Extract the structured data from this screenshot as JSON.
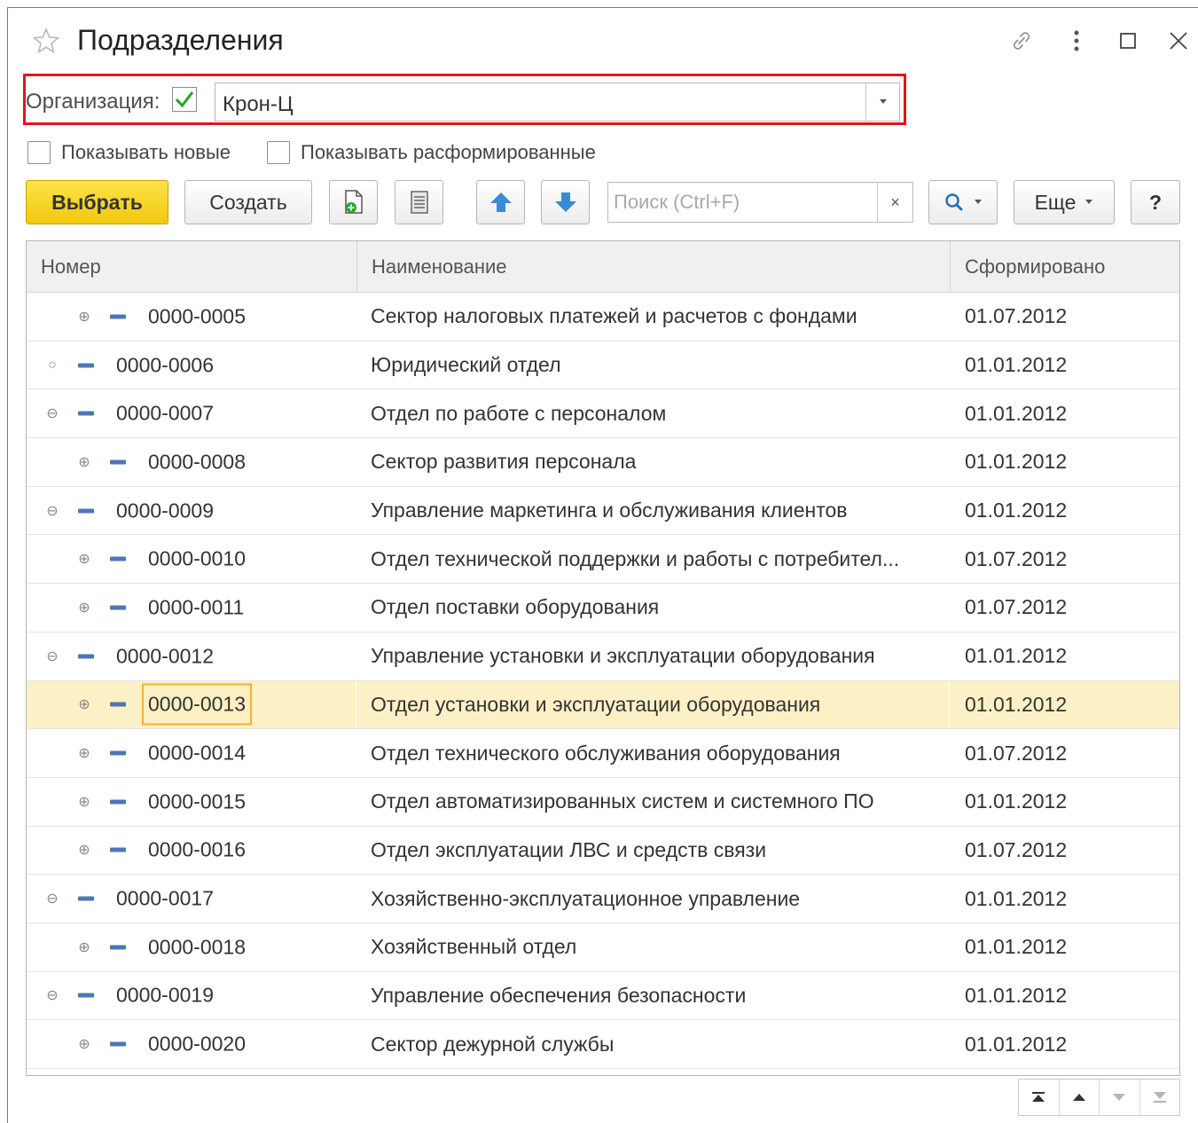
{
  "window": {
    "title": "Подразделения"
  },
  "organization": {
    "label": "Организация:",
    "checked": true,
    "value": "Крон-Ц"
  },
  "filters": {
    "show_new": "Показывать новые",
    "show_disbanded": "Показывать расформированные"
  },
  "toolbar": {
    "select": "Выбрать",
    "create": "Создать",
    "search_placeholder": "Поиск (Ctrl+F)",
    "search_clear": "×",
    "more": "Еще",
    "help": "?"
  },
  "table": {
    "columns": [
      "Номер",
      "Наименование",
      "Сформировано"
    ],
    "rows": [
      {
        "level": 2,
        "toggle": "plus",
        "number": "0000-0005",
        "name": "Сектор налоговых платежей и расчетов с фондами",
        "date": "01.07.2012"
      },
      {
        "level": 1,
        "toggle": "circle",
        "number": "0000-0006",
        "name": "Юридический отдел",
        "date": "01.01.2012"
      },
      {
        "level": 1,
        "toggle": "minus",
        "number": "0000-0007",
        "name": "Отдел по работе с персоналом",
        "date": "01.01.2012"
      },
      {
        "level": 2,
        "toggle": "plus",
        "number": "0000-0008",
        "name": "Сектор развития персонала",
        "date": "01.01.2012"
      },
      {
        "level": 1,
        "toggle": "minus",
        "number": "0000-0009",
        "name": "Управление маркетинга и обслуживания клиентов",
        "date": "01.01.2012"
      },
      {
        "level": 2,
        "toggle": "plus",
        "number": "0000-0010",
        "name": "Отдел технической поддержки и работы с потребител...",
        "date": "01.07.2012"
      },
      {
        "level": 2,
        "toggle": "plus",
        "number": "0000-0011",
        "name": "Отдел поставки оборудования",
        "date": "01.07.2012"
      },
      {
        "level": 1,
        "toggle": "minus",
        "number": "0000-0012",
        "name": "Управление установки и эксплуатации оборудования",
        "date": "01.01.2012"
      },
      {
        "level": 2,
        "toggle": "plus",
        "number": "0000-0013",
        "name": "Отдел установки и эксплуатации оборудования",
        "date": "01.01.2012",
        "selected": true
      },
      {
        "level": 2,
        "toggle": "plus",
        "number": "0000-0014",
        "name": "Отдел технического обслуживания оборудования",
        "date": "01.07.2012"
      },
      {
        "level": 2,
        "toggle": "plus",
        "number": "0000-0015",
        "name": "Отдел автоматизированных систем и системного ПО",
        "date": "01.01.2012"
      },
      {
        "level": 2,
        "toggle": "plus",
        "number": "0000-0016",
        "name": "Отдел эксплуатации ЛВС и средств связи",
        "date": "01.07.2012"
      },
      {
        "level": 1,
        "toggle": "minus",
        "number": "0000-0017",
        "name": "Хозяйственно-эксплуатационное управление",
        "date": "01.01.2012"
      },
      {
        "level": 2,
        "toggle": "plus",
        "number": "0000-0018",
        "name": "Хозяйственный отдел",
        "date": "01.01.2012"
      },
      {
        "level": 1,
        "toggle": "minus",
        "number": "0000-0019",
        "name": "Управление обеспечения безопасности",
        "date": "01.01.2012"
      },
      {
        "level": 2,
        "toggle": "plus",
        "number": "0000-0020",
        "name": "Сектор дежурной службы",
        "date": "01.01.2012"
      }
    ]
  },
  "colors": {
    "primary_button": "#f2c80f",
    "highlight_frame": "#e0141e",
    "selected_row": "#fcf1c6",
    "arrow_blue": "#3a8ad6",
    "check_green": "#2aa52a"
  },
  "icons": [
    "star-icon",
    "link-icon",
    "kebab-menu-icon",
    "maximize-icon",
    "close-icon",
    "checkmark-icon",
    "dropdown-arrow-icon",
    "add-copy-icon",
    "list-icon",
    "arrow-up-icon",
    "arrow-down-icon",
    "search-icon"
  ]
}
